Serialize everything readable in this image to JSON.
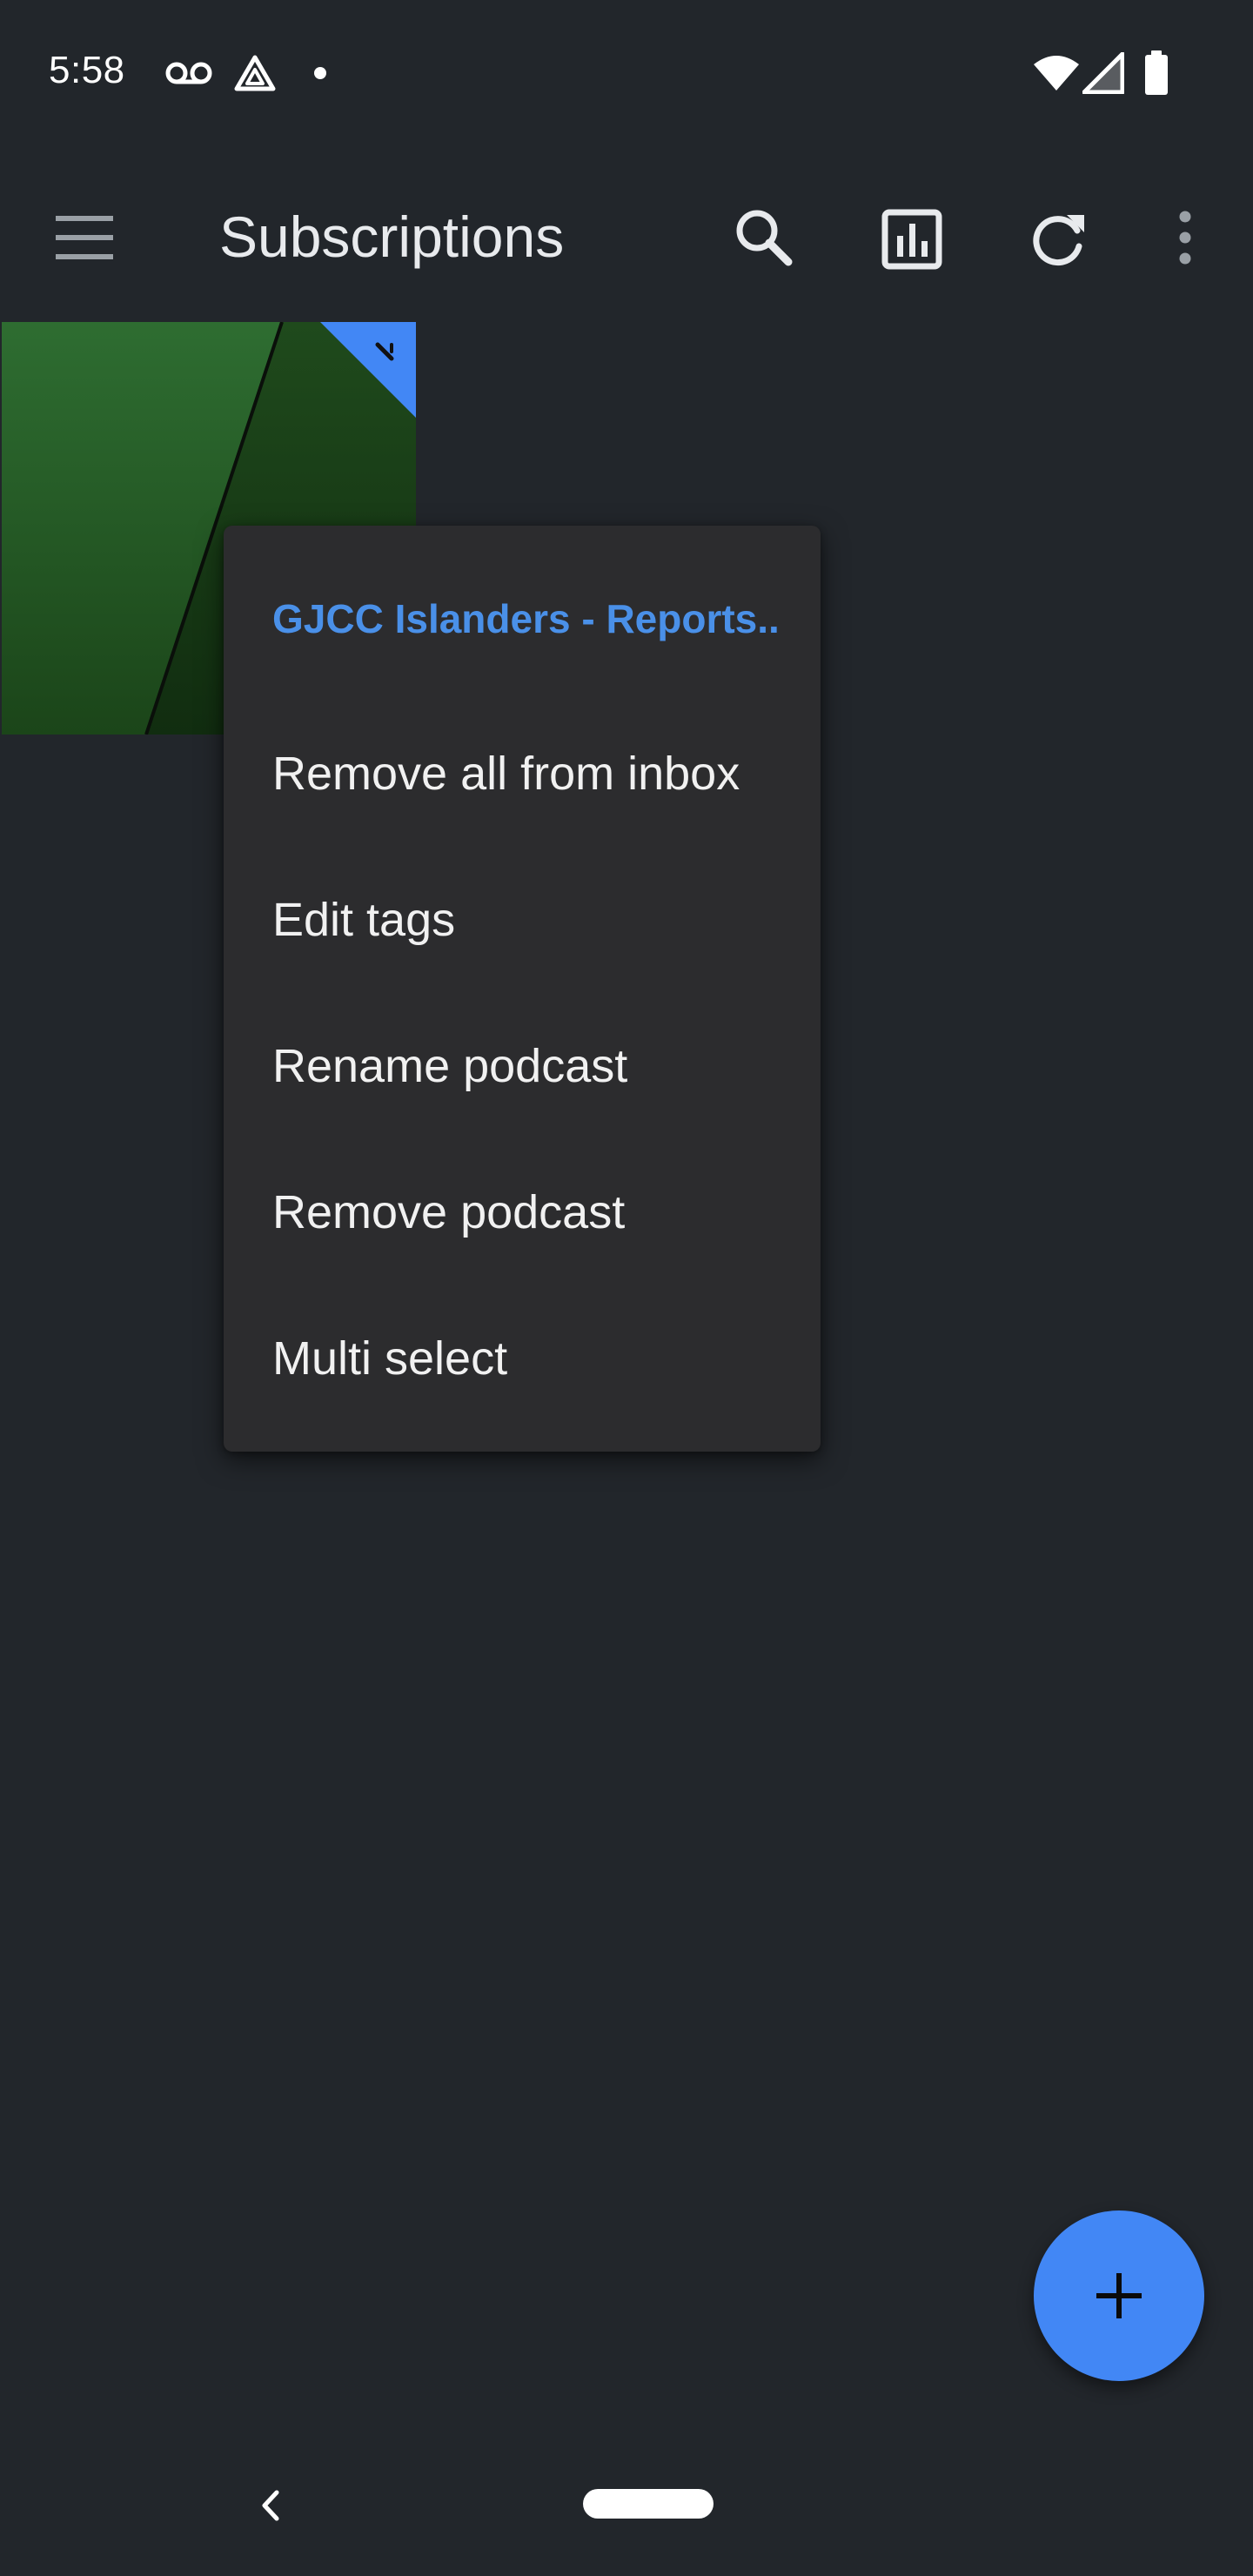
{
  "status_bar": {
    "time": "5:58",
    "icons": [
      "voicemail-icon",
      "drive-icon",
      "notification-dot-icon",
      "wifi-icon",
      "cell-signal-icon",
      "battery-icon"
    ]
  },
  "app_bar": {
    "title": "Subscriptions",
    "icons": [
      "menu-icon",
      "search-icon",
      "statistics-icon",
      "refresh-icon",
      "more-vert-icon"
    ]
  },
  "context_menu": {
    "header": "GJCC Islanders - Reports..",
    "items": [
      {
        "label": "Remove all from inbox"
      },
      {
        "label": "Edit tags"
      },
      {
        "label": "Rename podcast"
      },
      {
        "label": "Remove podcast"
      },
      {
        "label": "Multi select"
      }
    ]
  },
  "fab": {
    "icon": "add-icon"
  },
  "nav_bar": {
    "icons": [
      "back-icon",
      "home-pill-icon"
    ]
  },
  "colors": {
    "background": "#22262b",
    "menu_background": "#2c2c2e",
    "accent": "#4287f5",
    "header_text": "#4a90e8",
    "tile_green": "#2a6a2e",
    "tile_dark_green": "#1b4518"
  }
}
